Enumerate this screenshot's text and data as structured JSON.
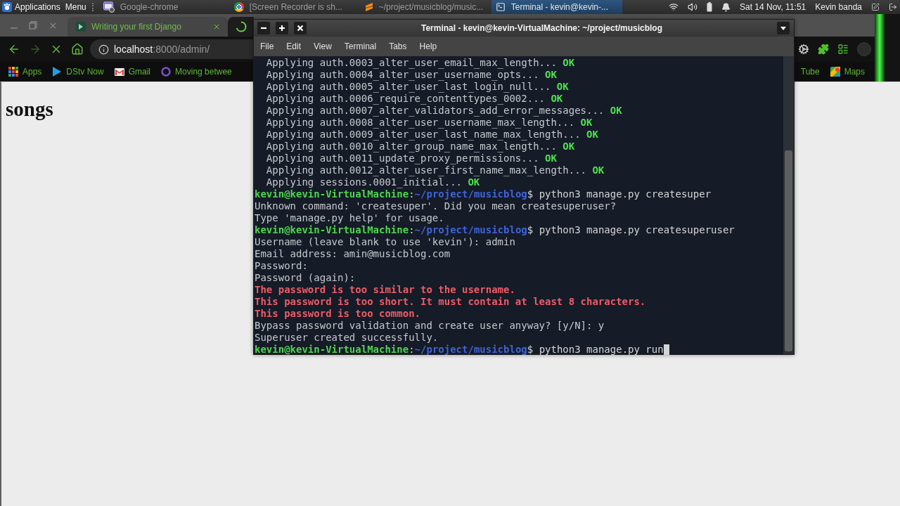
{
  "top_panel": {
    "applications": "Applications",
    "menu": "Menu",
    "tasks": [
      {
        "kind": "windows",
        "label": "Google-chrome",
        "selected": false
      },
      {
        "kind": "browser",
        "label": "[Screen Recorder is sh...",
        "selected": false
      },
      {
        "kind": "editor",
        "label": "~/project/musicblog/music...",
        "selected": false
      },
      {
        "kind": "terminal",
        "label": "Terminal - kevin@kevin-...",
        "selected": true
      }
    ],
    "clock": "Sat 14 Nov, 11:51",
    "user": "Kevin banda"
  },
  "browser": {
    "tab": {
      "title": "Writing your first Django"
    },
    "address": {
      "host": "localhost",
      "path": ":8000/admin/"
    },
    "bookmarks": [
      {
        "kind": "apps",
        "label": "Apps"
      },
      {
        "kind": "play",
        "label": "DStv Now"
      },
      {
        "kind": "mail",
        "label": "Gmail"
      },
      {
        "kind": "ring",
        "label": "Moving betwee"
      }
    ],
    "bookmarks_right": [
      {
        "kind": "plain",
        "label": "Tube"
      },
      {
        "kind": "map",
        "label": "Maps"
      }
    ],
    "page": {
      "heading": "songs"
    }
  },
  "terminal": {
    "title": "Terminal - kevin@kevin-VirtualMachine: ~/project/musicblog",
    "menu": [
      "File",
      "Edit",
      "View",
      "Terminal",
      "Tabs",
      "Help"
    ],
    "lines": [
      {
        "kind": "migration",
        "text": "Applying auth.0003_alter_user_email_max_length...",
        "status": "OK"
      },
      {
        "kind": "migration",
        "text": "Applying auth.0004_alter_user_username_opts...",
        "status": "OK"
      },
      {
        "kind": "migration",
        "text": "Applying auth.0005_alter_user_last_login_null...",
        "status": "OK"
      },
      {
        "kind": "migration",
        "text": "Applying auth.0006_require_contenttypes_0002...",
        "status": "OK"
      },
      {
        "kind": "migration",
        "text": "Applying auth.0007_alter_validators_add_error_messages...",
        "status": "OK"
      },
      {
        "kind": "migration",
        "text": "Applying auth.0008_alter_user_username_max_length...",
        "status": "OK"
      },
      {
        "kind": "migration",
        "text": "Applying auth.0009_alter_user_last_name_max_length...",
        "status": "OK"
      },
      {
        "kind": "migration",
        "text": "Applying auth.0010_alter_group_name_max_length...",
        "status": "OK"
      },
      {
        "kind": "migration",
        "text": "Applying auth.0011_update_proxy_permissions...",
        "status": "OK"
      },
      {
        "kind": "migration",
        "text": "Applying auth.0012_alter_user_first_name_max_length...",
        "status": "OK"
      },
      {
        "kind": "migration",
        "text": "Applying sessions.0001_initial...",
        "status": "OK"
      },
      {
        "kind": "prompt",
        "user": "kevin@kevin-VirtualMachine",
        "separator": ":",
        "path": "~/project/musicblog",
        "symbol": "$",
        "command": "python3 manage.py createsuper"
      },
      {
        "kind": "output",
        "text": "Unknown command: 'createsuper'. Did you mean createsuperuser?"
      },
      {
        "kind": "output",
        "text": "Type 'manage.py help' for usage."
      },
      {
        "kind": "prompt",
        "user": "kevin@kevin-VirtualMachine",
        "separator": ":",
        "path": "~/project/musicblog",
        "symbol": "$",
        "command": "python3 manage.py createsuperuser"
      },
      {
        "kind": "output",
        "text": "Username (leave blank to use 'kevin'): admin"
      },
      {
        "kind": "output",
        "text": "Email address: amin@musicblog.com"
      },
      {
        "kind": "output",
        "text": "Password:"
      },
      {
        "kind": "output",
        "text": "Password (again):"
      },
      {
        "kind": "error",
        "text": "The password is too similar to the username."
      },
      {
        "kind": "error",
        "text": "This password is too short. It must contain at least 8 characters."
      },
      {
        "kind": "error",
        "text": "This password is too common."
      },
      {
        "kind": "output",
        "text": "Bypass password validation and create user anyway? [y/N]: y"
      },
      {
        "kind": "output",
        "text": "Superuser created successfully."
      },
      {
        "kind": "prompt",
        "user": "kevin@kevin-VirtualMachine",
        "separator": ":",
        "path": "~/project/musicblog",
        "symbol": "$",
        "command": "python3 manage.py run"
      }
    ],
    "cursor": true
  }
}
